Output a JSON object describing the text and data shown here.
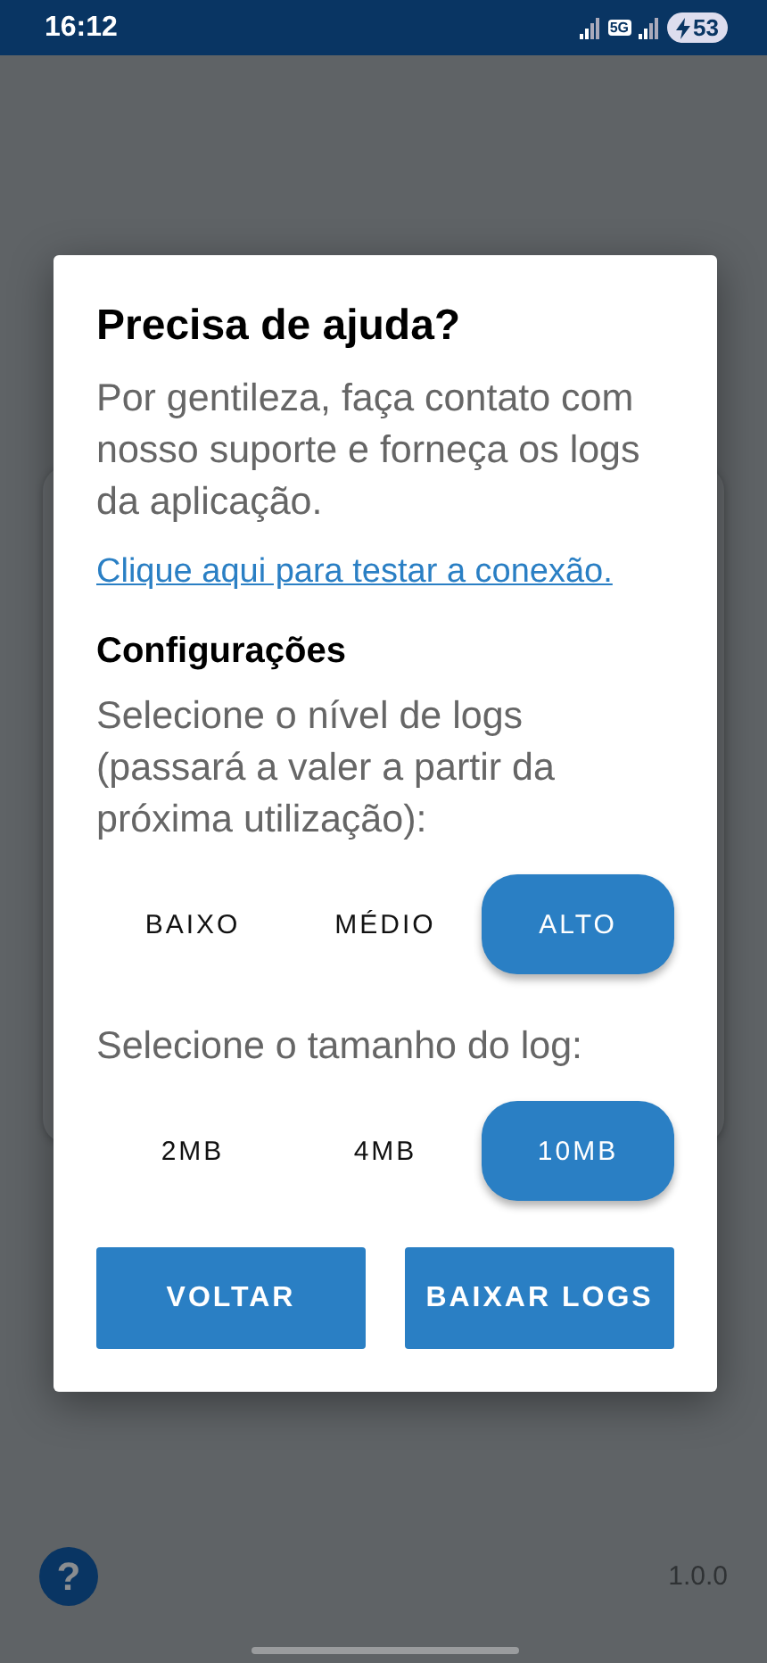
{
  "status_bar": {
    "time": "16:12",
    "network": "5G",
    "battery": "53"
  },
  "dialog": {
    "title": "Precisa de ajuda?",
    "message": "Por gentileza, faça contato com nosso suporte e forneça os logs da aplicação.",
    "link": "Clique aqui para testar a conexão.",
    "section_title": "Configurações",
    "log_level": {
      "label": "Selecione o nível de logs (passará a valer a partir da próxima utilização):",
      "options": [
        {
          "label": "BAIXO",
          "selected": false
        },
        {
          "label": "MÉDIO",
          "selected": false
        },
        {
          "label": "ALTO",
          "selected": true
        }
      ]
    },
    "log_size": {
      "label": "Selecione o tamanho do log:",
      "options": [
        {
          "label": "2MB",
          "selected": false
        },
        {
          "label": "4MB",
          "selected": false
        },
        {
          "label": "10MB",
          "selected": true
        }
      ]
    },
    "buttons": [
      "VOLTAR",
      "BAIXAR LOGS"
    ]
  },
  "footer": {
    "help": "?",
    "version": "1.0.0"
  }
}
